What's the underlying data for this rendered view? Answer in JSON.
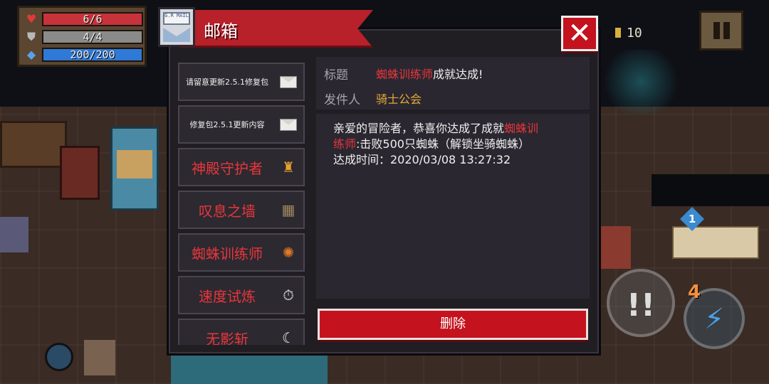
{
  "hud": {
    "hp": "6/6",
    "armor": "4/4",
    "energy": "200/200",
    "coins": "10",
    "hp_icon": "heart-icon",
    "armor_icon": "shield-icon",
    "energy_icon": "diamond-icon",
    "hp_fill": 1.0,
    "armor_fill": 1.0,
    "energy_fill": 1.0,
    "colors": {
      "hp": "#c8323a",
      "armor": "#8a8a8a",
      "energy": "#2f7ad6"
    }
  },
  "controls": {
    "skill_symbol": "!!",
    "attack_symbol": "⚡",
    "energy_cost": "4",
    "swap_cost": "1"
  },
  "mailbox": {
    "title": "邮箱",
    "icon_text": "G.R MAIL",
    "close_symbol": "✕",
    "list": [
      {
        "label": "请留意更新2.5.1修复包",
        "icon": "envelope-icon"
      },
      {
        "label": "修复包2.5.1更新内容",
        "icon": "envelope-icon"
      },
      {
        "label": "神殿守护者",
        "icon": "guardian-badge-icon"
      },
      {
        "label": "叹息之墙",
        "icon": "wall-badge-icon"
      },
      {
        "label": "蜘蛛训练师",
        "icon": "spider-badge-icon"
      },
      {
        "label": "速度试炼",
        "icon": "stopwatch-icon"
      },
      {
        "label": "无影斩",
        "icon": "crescent-slash-icon"
      }
    ],
    "detail": {
      "subject_label": "标题",
      "subject_highlight": "蜘蛛训练师",
      "subject_suffix": "成就达成!",
      "sender_label": "发件人",
      "sender": "骑士公会",
      "body_line1_prefix": "亲爱的冒险者，恭喜你达成了成就",
      "body_line1_highlight": "蜘蛛训",
      "body_line2_highlight": "练师",
      "body_line2_suffix": ":击败500只蜘蛛（解锁坐骑蜘蛛）",
      "body_line3": "达成时间：2020/03/08 13:27:32"
    },
    "delete_label": "删除",
    "colors": {
      "banner": "#b8202a",
      "highlight_red": "#e8363c",
      "sender_gold": "#e6a838",
      "button_red": "#c4121e"
    }
  }
}
